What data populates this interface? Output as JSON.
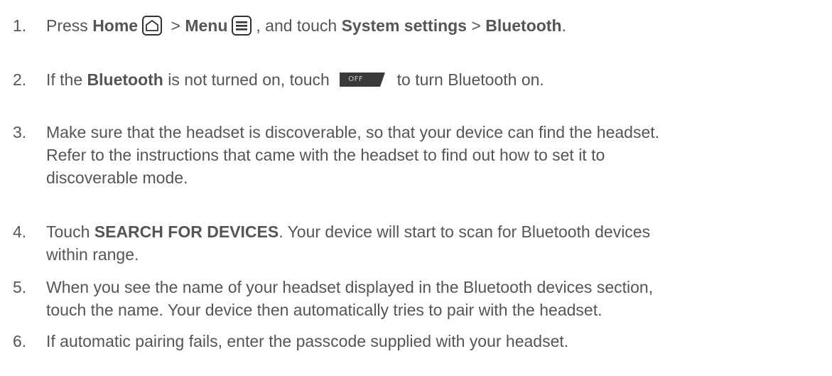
{
  "steps": [
    {
      "number": "1.",
      "t1": "Press ",
      "b1": "Home",
      "t2": " > ",
      "b2": "Menu",
      "t3": ", and touch ",
      "b3": "System settings",
      "t4": " > ",
      "b4": "Bluetooth",
      "t5": ".",
      "icons": [
        "home-icon",
        "menu-icon"
      ]
    },
    {
      "number": "2.",
      "t1": "If the ",
      "b1": "Bluetooth",
      "t2": " is not turned on, touch ",
      "toggle_label": "OFF",
      "t3": " to turn Bluetooth on."
    },
    {
      "number": "3.",
      "lines": [
        "Make sure that the headset is discoverable, so that your device can find the headset.",
        "Refer to the instructions that came with the headset to find out how to set it to",
        "discoverable mode."
      ]
    },
    {
      "number": "4.",
      "t1": "Touch ",
      "b1": "SEARCH FOR DEVICES",
      "t2": ". Your device will start to scan for Bluetooth devices",
      "line2": "within range."
    },
    {
      "number": "5.",
      "lines": [
        "When you see the name of your headset displayed in the Bluetooth devices section,",
        "touch the name. Your device then automatically tries to pair with the headset."
      ]
    },
    {
      "number": "6.",
      "text": "If automatic pairing fails, enter the passcode supplied with your headset."
    }
  ],
  "colors": {
    "text": "#555555",
    "toggle_bg": "#3a3a3a",
    "icon_stroke": "#333333"
  }
}
